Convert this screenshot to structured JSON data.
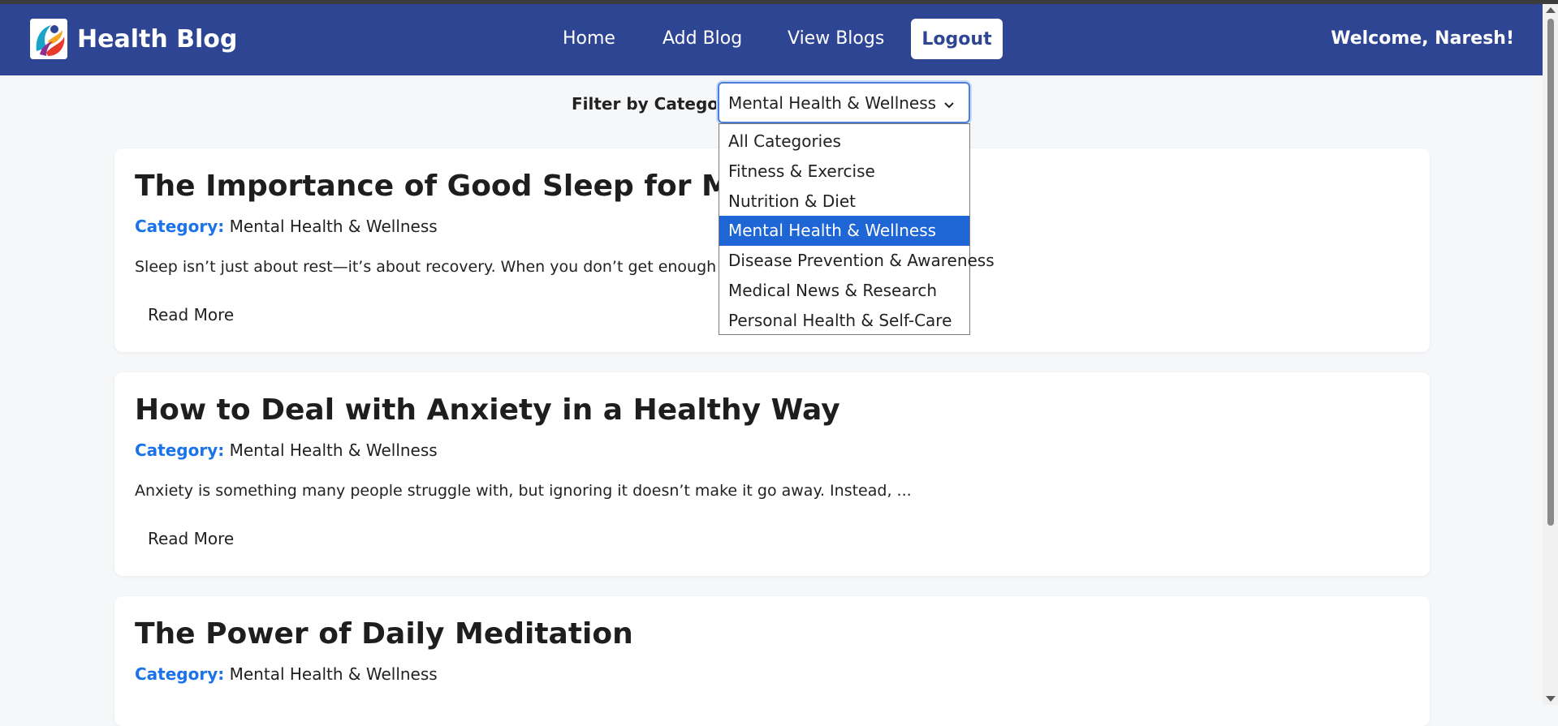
{
  "header": {
    "brand": "Health Blog",
    "nav": [
      "Home",
      "Add Blog",
      "View Blogs"
    ],
    "logout_label": "Logout",
    "welcome": "Welcome, Naresh!"
  },
  "filter": {
    "label": "Filter by Category:",
    "selected": "Mental Health & Wellness",
    "options": [
      "All Categories",
      "Fitness & Exercise",
      "Nutrition & Diet",
      "Mental Health & Wellness",
      "Disease Prevention & Awareness",
      "Medical News & Research",
      "Personal Health & Self-Care"
    ]
  },
  "posts": [
    {
      "title": "The Importance of Good Sleep for Mental Health",
      "category_label": "Category:",
      "category": "Mental Health & Wellness",
      "excerpt": "Sleep isn’t just about rest—it’s about recovery. When you don’t get enough sleep, ...",
      "read_more": "Read More"
    },
    {
      "title": "How to Deal with Anxiety in a Healthy Way",
      "category_label": "Category:",
      "category": "Mental Health & Wellness",
      "excerpt": "Anxiety is something many people struggle with, but ignoring it doesn’t make it go away. Instead, ...",
      "read_more": "Read More"
    },
    {
      "title": "The Power of Daily Meditation",
      "category_label": "Category:",
      "category": "Mental Health & Wellness"
    }
  ],
  "colors": {
    "navbar": "#2e4594",
    "accent": "#1a73e8",
    "selected_option": "#1e66d6",
    "page_bg": "#f6f7f9"
  },
  "icons": [
    "health-logo-icon",
    "chevron-down-icon"
  ]
}
